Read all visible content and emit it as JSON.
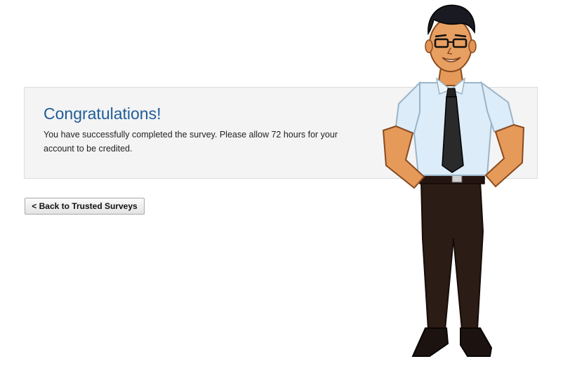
{
  "message": {
    "title": "Congratulations!",
    "body": "You have successfully completed the survey. Please allow 72 hours for your account to be credited."
  },
  "actions": {
    "back_label": "< Back to Trusted Surveys"
  },
  "colors": {
    "title": "#1f5c99",
    "panel_background": "#f4f4f4",
    "panel_border": "#dcdcdc"
  },
  "illustration": {
    "icon": "cartoon-man-mascot"
  }
}
